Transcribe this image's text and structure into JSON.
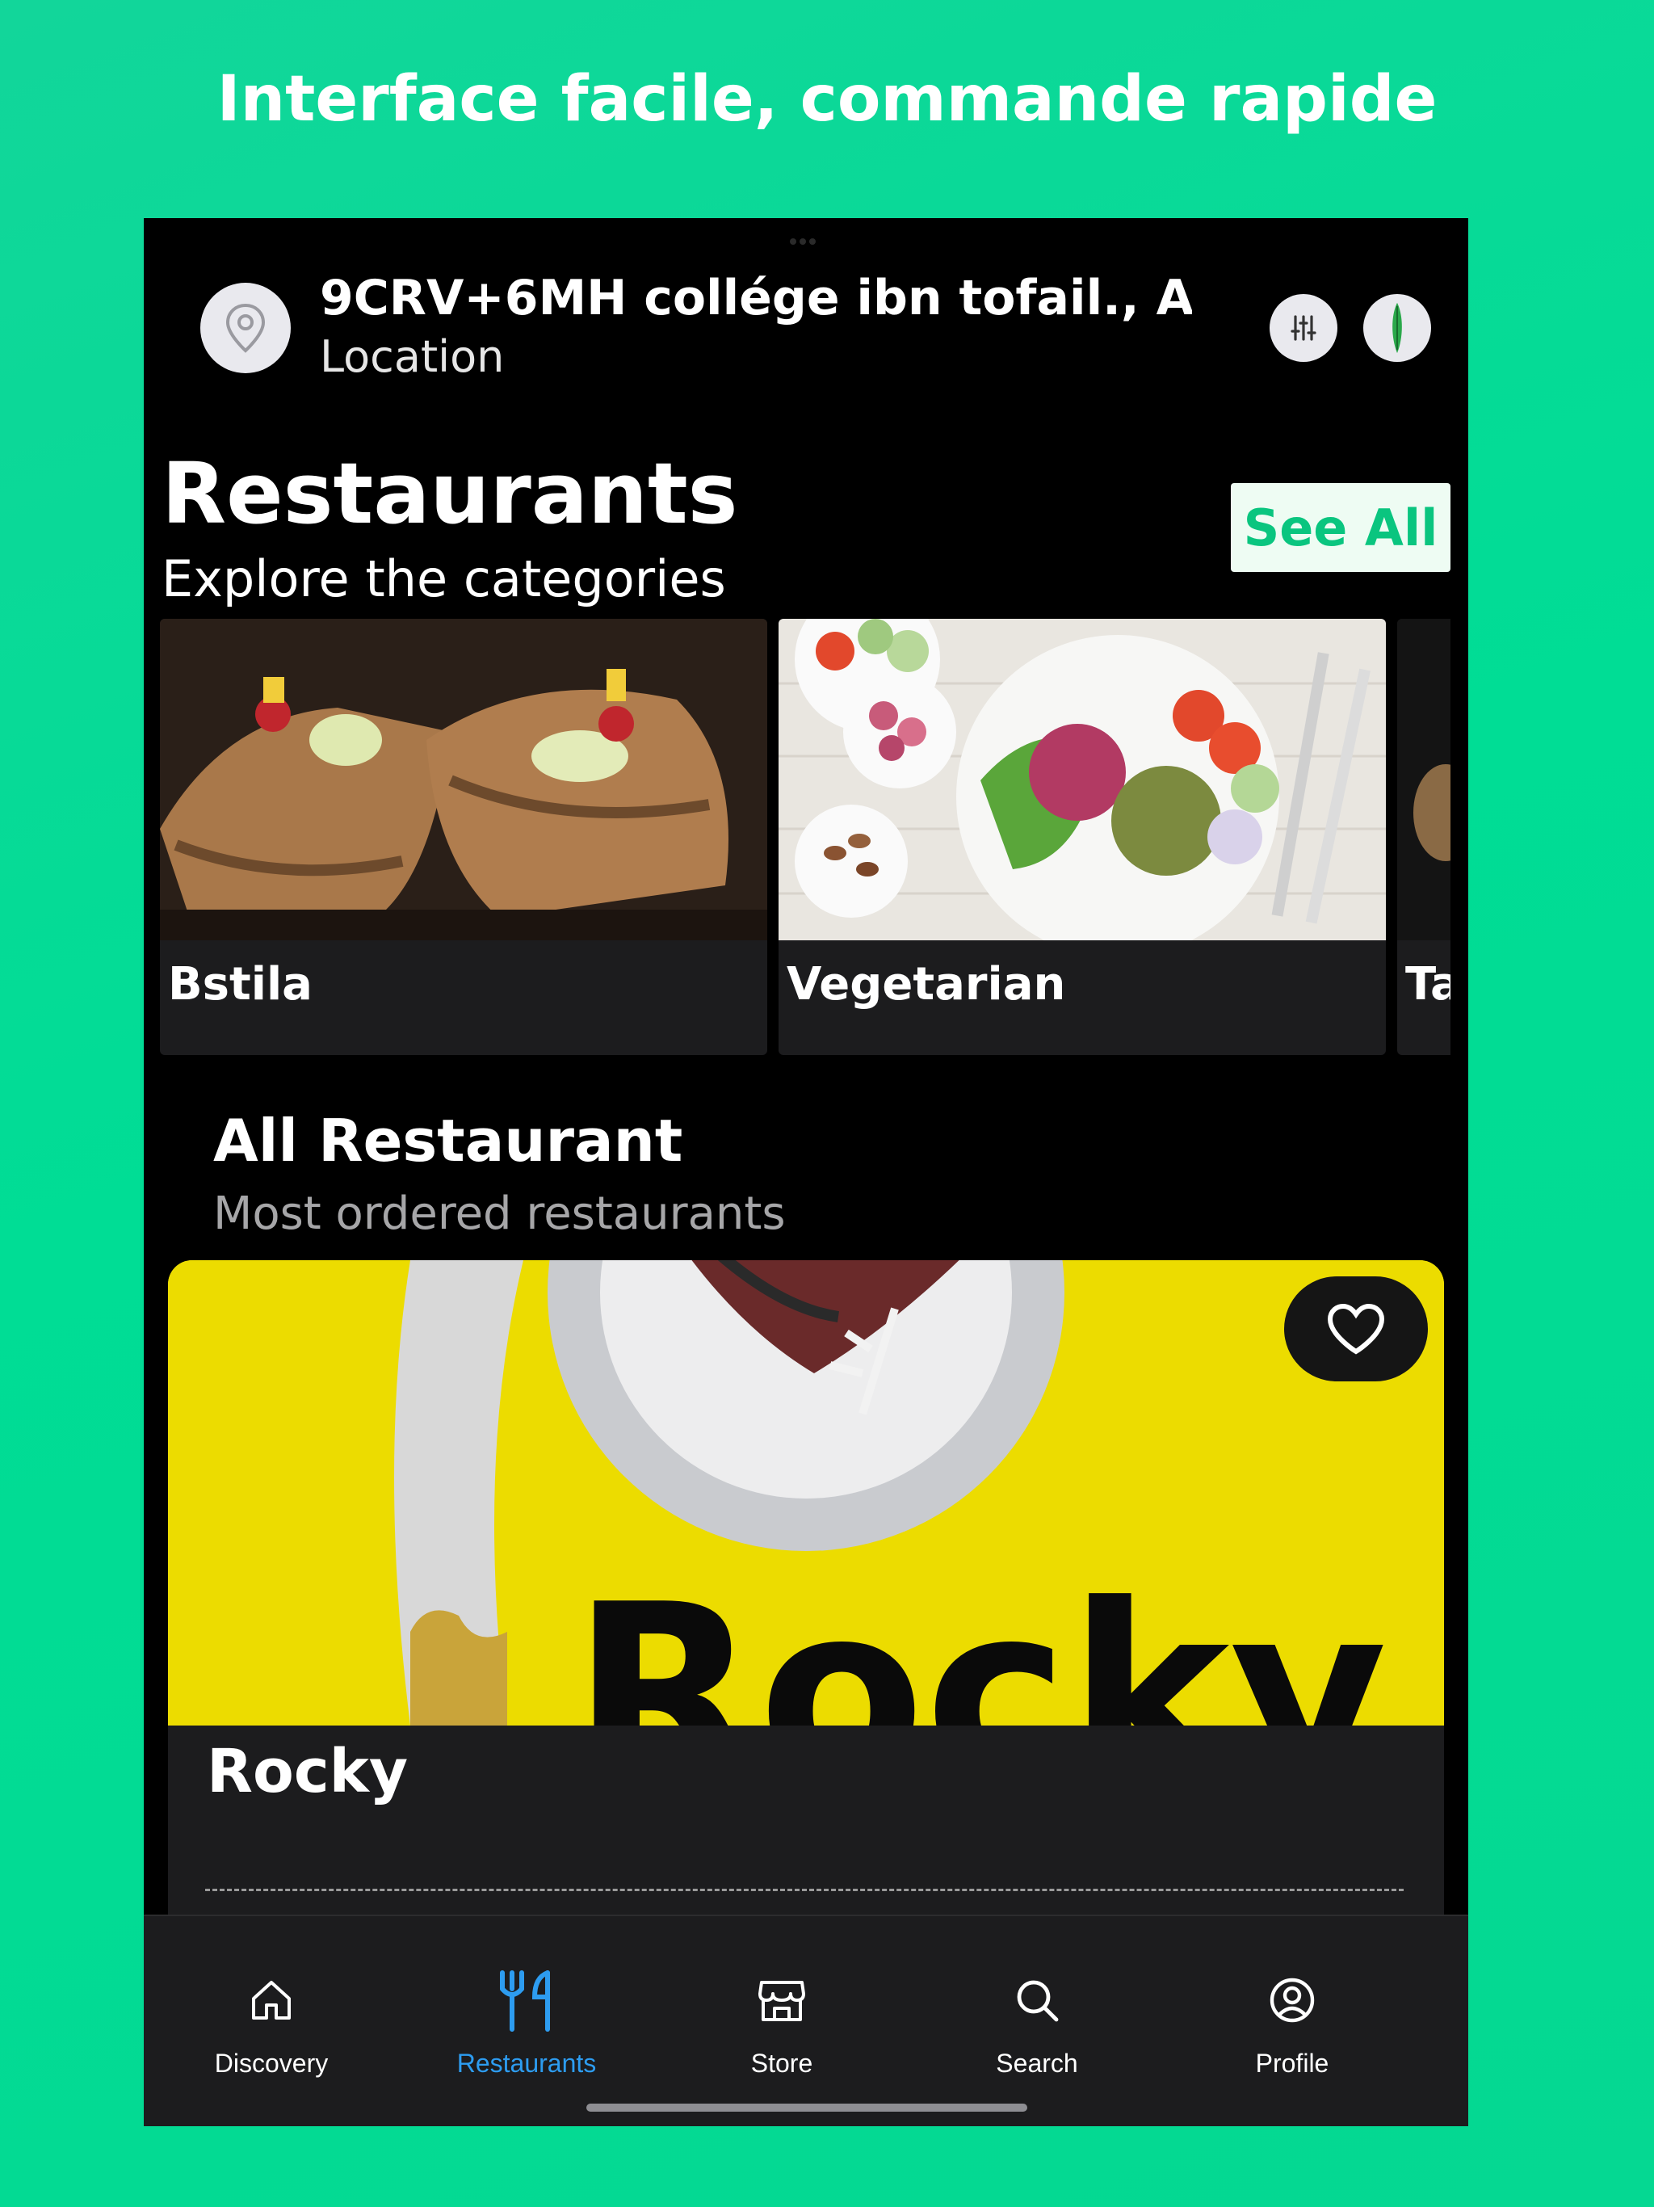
{
  "promo": {
    "title": "Interface facile, commande rapide"
  },
  "header": {
    "address": "9CRV+6MH collége ibn tofail., A...",
    "location_label": "Location",
    "pin_icon": "map-pin-icon",
    "filter_icon": "sliders-icon",
    "avatar_icon": "leaf-icon"
  },
  "restaurants_section": {
    "title": "Restaurants",
    "subtitle": "Explore the categories",
    "see_all_label": "See All",
    "categories": [
      {
        "name": "Bstila"
      },
      {
        "name": "Vegetarian"
      },
      {
        "name": "Ta"
      }
    ]
  },
  "all_restaurants": {
    "title": "All Restaurant",
    "subtitle": "Most ordered restaurants",
    "items": [
      {
        "name": "Rocky",
        "logo_text": "Rocky",
        "favorite_icon": "heart-icon"
      }
    ]
  },
  "tab_bar": {
    "tabs": [
      {
        "label": "Discovery",
        "icon": "home-icon",
        "active": false
      },
      {
        "label": "Restaurants",
        "icon": "fork-knife-icon",
        "active": true
      },
      {
        "label": "Store",
        "icon": "store-icon",
        "active": false
      },
      {
        "label": "Search",
        "icon": "search-icon",
        "active": false
      },
      {
        "label": "Profile",
        "icon": "profile-icon",
        "active": false
      }
    ]
  },
  "colors": {
    "background": "#00dd95",
    "accent": "#0ac57f",
    "active_tab": "#2d9cf0",
    "card": "#1c1c1e",
    "rocky_yellow": "#ecdc00"
  }
}
